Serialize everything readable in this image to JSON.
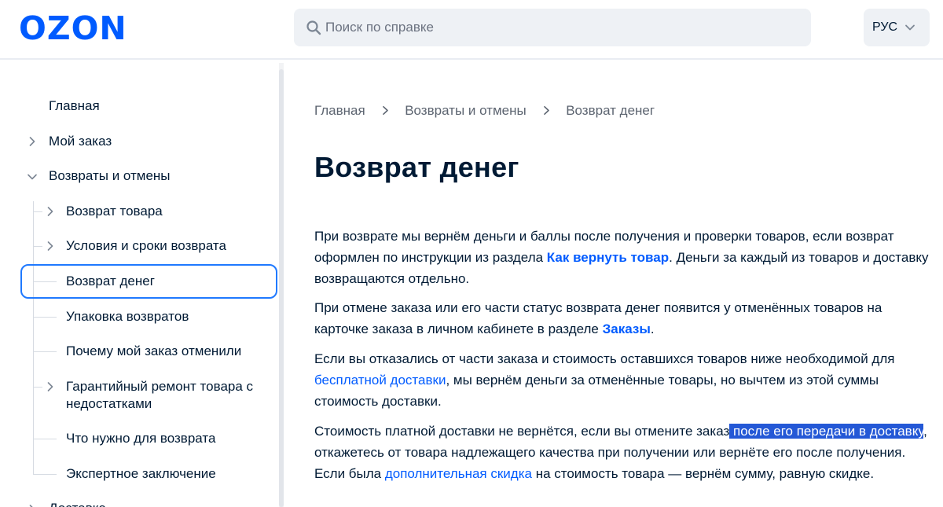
{
  "header": {
    "logo": "OZON",
    "search_placeholder": "Поиск по справке",
    "lang_label": "РУС"
  },
  "sidebar": {
    "items": [
      {
        "label": "Главная"
      },
      {
        "label": "Мой заказ"
      },
      {
        "label": "Возвраты и отмены"
      },
      {
        "label": "Возврат товара"
      },
      {
        "label": "Условия и сроки возврата"
      },
      {
        "label": "Возврат денег"
      },
      {
        "label": "Упаковка возвратов"
      },
      {
        "label": "Почему мой заказ отменили"
      },
      {
        "label": "Гарантийный ремонт товара с"
      },
      {
        "label": "недостатками"
      },
      {
        "label": "Что нужно для возврата"
      },
      {
        "label": "Экспертное заключение"
      },
      {
        "label": "Доставка"
      }
    ]
  },
  "breadcrumb": [
    "Главная",
    "Возвраты и отмены",
    "Возврат денег"
  ],
  "page": {
    "title": "Возврат денег",
    "p1": {
      "a": "При возврате мы вернём деньги и баллы после получения и проверки товаров, если возврат оформлен по инструкции из раздела ",
      "link": "Как вернуть товар",
      "b": ". Деньги за каждый из товаров и доставку возвращаются отдельно."
    },
    "p2": {
      "a": "При отмене заказа или его части статус возврата денег появится у отменённых товаров на карточке заказа в личном кабинете в разделе ",
      "link": "Заказы",
      "b": "."
    },
    "p3": {
      "a": "Если вы отказались от части заказа и стоимость оставшихся товаров ниже необходимой для ",
      "link": "бесплатной доставки",
      "b": ", мы вернём деньги за отменённые товары, но вычтем из этой суммы стоимость доставки."
    },
    "p4": {
      "a": "Стоимость платной доставки не вернётся, если вы отмените заказ",
      "sel": " после его передачи в доставку",
      "b": ", откажетесь от товара надлежащего качества при получении или вернёте его после получения. Если была ",
      "link": "дополнительная скидка",
      "c": " на стоимость товара — вернём сумму, равную скидке."
    }
  },
  "colors": {
    "brand": "#005bff",
    "active_outline": "#1f79ff",
    "selection": "#2458d6"
  }
}
